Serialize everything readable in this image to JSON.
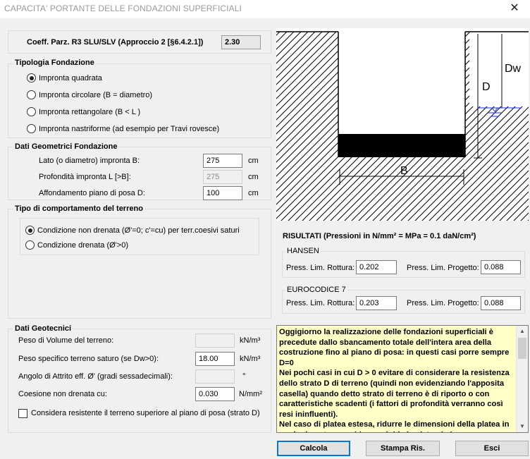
{
  "window": {
    "title": "CAPACITA' PORTANTE DELLE FONDAZIONI SUPERFICIALI",
    "close_glyph": "✕"
  },
  "coeff": {
    "label": "Coeff. Parz. R3 SLU/SLV (Approccio 2 [§6.4.2.1])",
    "value": "2.30"
  },
  "tipologia": {
    "title": "Tipologia Fondazione",
    "options": [
      {
        "label": "Impronta quadrata",
        "selected": true
      },
      {
        "label": "Impronta circolare (B = diametro)",
        "selected": false
      },
      {
        "label": "Impronta rettangolare (B < L )",
        "selected": false
      },
      {
        "label": "Impronta nastriforme (ad esempio per Travi rovesce)",
        "selected": false
      }
    ]
  },
  "geometrici": {
    "title": "Dati Geometrici Fondazione",
    "rows": [
      {
        "label": "Lato (o diametro) impronta B:",
        "value": "275",
        "unit": "cm",
        "enabled": true
      },
      {
        "label": "Profondità impronta L [>B]:",
        "value": "275",
        "unit": "cm",
        "enabled": false
      },
      {
        "label": "Affondamento piano di posa  D:",
        "value": "100",
        "unit": "cm",
        "enabled": true
      }
    ]
  },
  "comportamento": {
    "title": "Tipo di comportamento del terreno",
    "options": [
      {
        "label": "Condizione non drenata (Ø'=0; c'=cu) per terr.coesivi saturi",
        "selected": true
      },
      {
        "label": "Condizione drenata  (Ø'>0)",
        "selected": false
      }
    ]
  },
  "geotecnici": {
    "title": "Dati Geotecnici",
    "rows": [
      {
        "label": "Peso di Volume del terreno:",
        "value": "",
        "unit": "kN/m³",
        "enabled": false
      },
      {
        "label": "Peso specifico terreno saturo (se Dw>0):",
        "value": "18.00",
        "unit": "kN/m³",
        "enabled": true
      },
      {
        "label": "Angolo di Attrito eff.  Ø'  (gradi sessadecimali):",
        "value": "",
        "unit": "°",
        "enabled": false
      },
      {
        "label": "Coesione non drenata  cu:",
        "value": "0.030",
        "unit": "N/mm²",
        "enabled": true
      }
    ],
    "checkbox_label": "Considera resistente il terreno superiore al piano di posa (strato D)",
    "checkbox_checked": false
  },
  "diagram": {
    "label_d": "D",
    "label_dw": "Dw",
    "label_b": "B"
  },
  "risultati": {
    "title": "RISULTATI (Pressioni in N/mm² = MPa = 0.1 daN/cm²)",
    "groups": [
      {
        "name": "HANSEN",
        "rottura_label": "Press. Lim. Rottura:",
        "rottura": "0.202",
        "progetto_label": "Press. Lim. Progetto:",
        "progetto": "0.088"
      },
      {
        "name": "EUROCODICE 7",
        "rottura_label": "Press. Lim. Rottura:",
        "rottura": "0.203",
        "progetto_label": "Press. Lim. Progetto:",
        "progetto": "0.088"
      }
    ]
  },
  "info_text": "Oggigiorno la realizzazione delle fondazioni superficiali è precedute dallo sbancamento totale dell'intera area della costruzione fino al piano di posa: in questi casi porre sempre D=0\nNei pochi casi in cui D > 0 evitare di considerare la resistenza dello strato D di terreno (quindi non evidenziando l'apposita casella) quando detto strato di terreno è di riporto o con caratteristiche scadenti (i fattori di profondità verranno così resi ininfluenti).\nNel caso di platea estesa, ridurre le dimensioni della platea in modo da poter considerare rigida la platea (ad es.",
  "buttons": {
    "calcola": "Calcola",
    "stampa": "Stampa Ris.",
    "esci": "Esci"
  }
}
